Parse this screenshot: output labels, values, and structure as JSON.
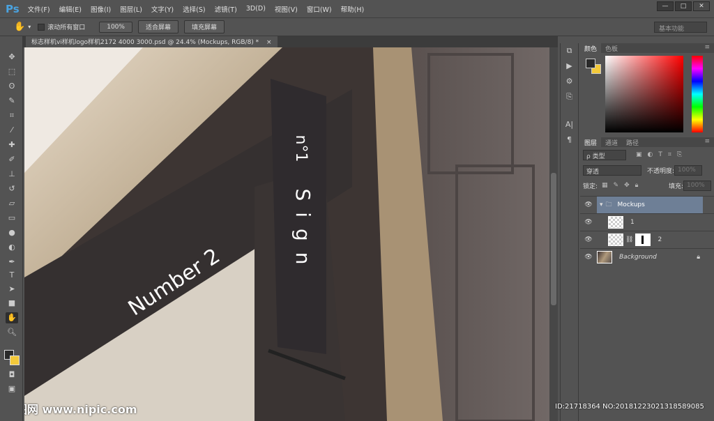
{
  "app": {
    "logo": "Ps"
  },
  "menu": [
    "文件(F)",
    "编辑(E)",
    "图像(I)",
    "图层(L)",
    "文字(Y)",
    "选择(S)",
    "滤镜(T)",
    "3D(D)",
    "视图(V)",
    "窗口(W)",
    "帮助(H)"
  ],
  "window_buttons": [
    "—",
    "□",
    "✕"
  ],
  "options": {
    "scroll_all": "滚动所有窗口",
    "zoom100": "100%",
    "fit_screen": "适合屏幕",
    "fill_screen": "填充屏幕",
    "workspace": "基本功能"
  },
  "document_tab": {
    "title": "标志样机vi样机logo样机2172 4000 3000.psd @ 24.4% (Mockups, RGB/8) *",
    "close": "×"
  },
  "canvas_text": {
    "sign_no": "n°1",
    "sign_word": "Sign",
    "facade": "Number 2"
  },
  "color_panel": {
    "tabs": [
      "颜色",
      "色板"
    ],
    "fg": "#2a2a2a",
    "bg": "#f3c93a",
    "hue": "#ff0000"
  },
  "layers_panel": {
    "tabs": [
      "图层",
      "通道",
      "路径"
    ],
    "filter": "ρ 类型",
    "blend_mode": "穿透",
    "opacity_label": "不透明度:",
    "opacity": "100%",
    "lock_label": "锁定:",
    "fill_label": "填充:",
    "fill": "100%",
    "layers": [
      {
        "name": "Mockups",
        "type": "group",
        "selected": true
      },
      {
        "name": "1",
        "type": "smart"
      },
      {
        "name": "2",
        "type": "smart-mask"
      },
      {
        "name": "Background",
        "type": "background",
        "locked": true
      }
    ]
  },
  "watermark": {
    "left": "昵图网 www.nipic.com",
    "right": "ID:21718364 NO:20181223021318589085"
  }
}
